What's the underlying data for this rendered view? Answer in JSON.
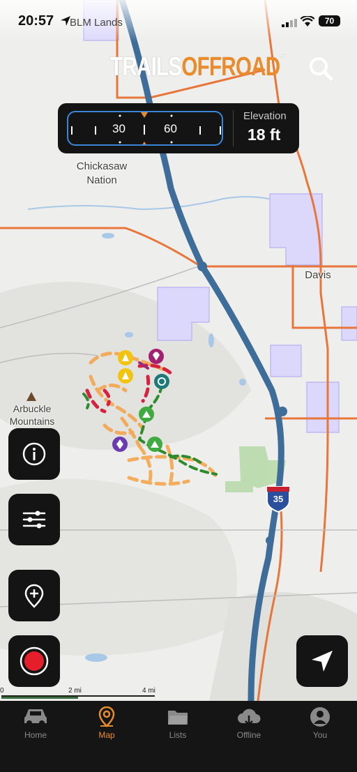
{
  "status_bar": {
    "time": "20:57",
    "battery": "70",
    "overlay_label": "BLM Lands"
  },
  "header": {
    "logo_part1": "TRAILS",
    "logo_part2": "OFFROAD",
    "logo_tm": "™"
  },
  "compass": {
    "tick_a": "30",
    "tick_b": "60",
    "elevation_label": "Elevation",
    "elevation_value": "18 ft"
  },
  "map": {
    "labels": {
      "chickasaw": "Chickasaw Nation",
      "davis": "Davis",
      "arbuckle": "Arbuckle Mountains",
      "interstate": "35"
    },
    "scale": {
      "zero": "0",
      "mid": "2 mi",
      "end": "4 mi"
    },
    "colors": {
      "road_major": "#3f6d99",
      "road_minor": "#e8753a",
      "trail_easy": "#2d8a2d",
      "trail_moderate": "#f4a64e",
      "trail_hard": "#d6223f",
      "public_land": "#c9c3f5",
      "park": "#b5d9a7"
    }
  },
  "side_buttons": {
    "info": "info-icon",
    "filters": "sliders-icon",
    "add_waypoint": "add-pin-icon",
    "record": "record-icon",
    "locate": "navigate-icon"
  },
  "tabs": [
    {
      "label": "Home",
      "icon": "jeep-icon",
      "active": false
    },
    {
      "label": "Map",
      "icon": "map-pin-icon",
      "active": true
    },
    {
      "label": "Lists",
      "icon": "folder-icon",
      "active": false
    },
    {
      "label": "Offline",
      "icon": "cloud-download-icon",
      "active": false
    },
    {
      "label": "You",
      "icon": "user-icon",
      "active": false
    }
  ]
}
